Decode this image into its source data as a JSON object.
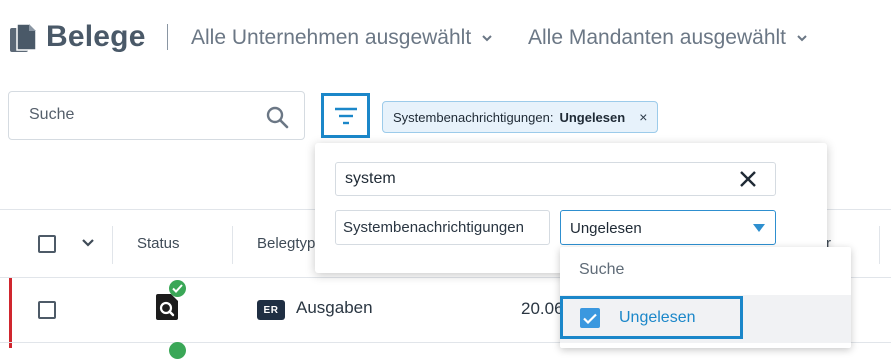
{
  "header": {
    "title": "Belege",
    "company_select": "Alle Unternehmen ausgewählt",
    "client_select": "Alle Mandanten ausgewählt"
  },
  "search": {
    "placeholder": "Suche"
  },
  "active_filter_chip": {
    "key": "Systembenachrichtigungen:",
    "value": "Ungelesen",
    "remove": "×"
  },
  "filter_popover": {
    "search_value": "system",
    "field_label": "Systembenachrichtigungen",
    "selected_value": "Ungelesen"
  },
  "dropdown": {
    "search_option": "Suche",
    "options": [
      {
        "label": "Ungelesen",
        "checked": true
      }
    ]
  },
  "table": {
    "columns": {
      "status": "Status",
      "belegtyp": "Belegtyp",
      "right": "r"
    },
    "rows": [
      {
        "badge": "ER",
        "type": "Ausgaben",
        "date": "20.06"
      }
    ]
  },
  "colors": {
    "accent": "#1b87c9",
    "status_ok": "#3aa757",
    "row_marker": "#d0262e",
    "badge_bg": "#1f2f43"
  }
}
